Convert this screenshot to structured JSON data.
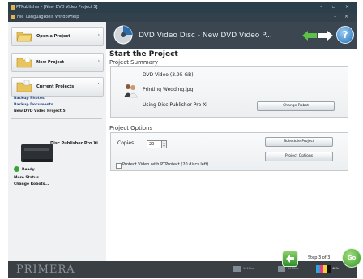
{
  "window": {
    "title": "PTPublisher - [New DVD Video Project 5]",
    "controls": "– ▫ ×"
  },
  "menu": {
    "items": [
      "File",
      "Language",
      "Tools",
      "Window",
      "Help"
    ],
    "controls": "– ×"
  },
  "sidebar": {
    "open_project": "Open a Project",
    "new_project": "New Project",
    "current_projects": "Current Projects",
    "project_links": [
      "Backup Photos",
      "Backup Documents",
      "New DVD Video Project 5"
    ],
    "printer_name": "Disc Publisher Pro Xi",
    "printer_status": "Ready",
    "more_status": "More Status",
    "change_robots": "Change Robots..."
  },
  "header": {
    "title": "DVD Video Disc  -  New DVD Video P..."
  },
  "main": {
    "heading": "Start the Project",
    "summary_title": "Project Summary",
    "summary_disc": "DVD Video (3.95 GB)",
    "summary_file": "Printing Wedding.jpg",
    "summary_robot": "Using Disc Publisher Pro Xi",
    "change_robot_btn": "Change Robot",
    "options_title": "Project Options",
    "copies_label": "Copies",
    "copies_value": "20",
    "schedule_btn": "Schedule Project",
    "project_options_btn": "Project Options",
    "protect_label": "Protect Video with PTProtect (20 discs left)"
  },
  "footer": {
    "brand": "PRIMERA",
    "step": "Step 3 of 3",
    "go": "Go",
    "disk1": "101Gbs",
    "disk2": "101Gbs",
    "ink": "48%"
  },
  "colors": {
    "accent": "#3b4650",
    "go_green": "#2f9628",
    "link_blue": "#2a4b8a"
  }
}
